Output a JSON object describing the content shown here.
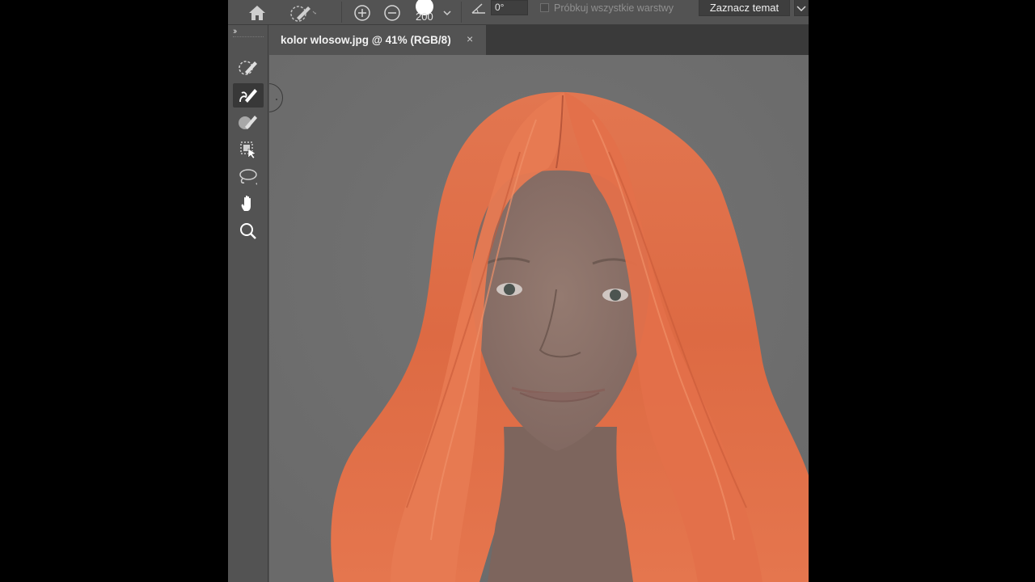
{
  "options_bar": {
    "home_icon": "home-icon",
    "tool_preset_icon": "quick-select-brush-icon",
    "add_to_selection_icon": "add-selection-icon",
    "subtract_selection_icon": "subtract-selection-icon",
    "brush_size": "200",
    "angle_icon": "angle-icon",
    "angle_value": "0°",
    "sample_all_layers_label": "Próbkuj wszystkie warstwy",
    "sample_all_layers_checked": false,
    "select_subject_label": "Zaznacz temat"
  },
  "toolbar": {
    "collapse_label": "››",
    "tools": [
      {
        "name": "object-selection-icon",
        "active": false
      },
      {
        "name": "quick-selection-icon",
        "active": true
      },
      {
        "name": "magic-wand-brush-icon",
        "active": false
      },
      {
        "name": "object-select-arrow-icon",
        "active": false
      },
      {
        "name": "lasso-icon",
        "active": false
      },
      {
        "name": "hand-icon",
        "active": false
      },
      {
        "name": "zoom-icon",
        "active": false
      }
    ]
  },
  "document": {
    "tab_title": "kolor wlosow.jpg @ 41% (RGB/8)",
    "close_label": "×"
  },
  "colors": {
    "hair": "#e0704a",
    "canvas_bg": "#6e6e6e",
    "skin": "#8c7369"
  }
}
